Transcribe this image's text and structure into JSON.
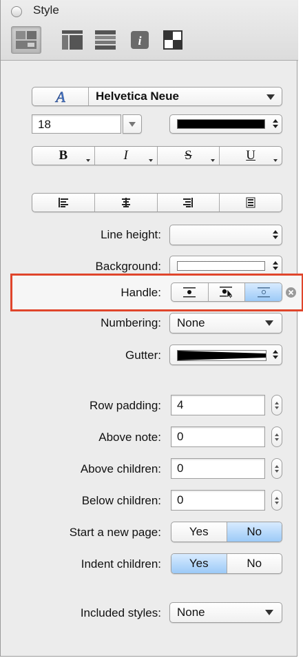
{
  "window": {
    "title": "Style"
  },
  "tabs": [
    {
      "icon": "style-grid-icon",
      "selected": true
    },
    {
      "icon": "columns-icon",
      "selected": false
    },
    {
      "icon": "rows-icon",
      "selected": false
    },
    {
      "icon": "info-icon",
      "selected": false
    },
    {
      "icon": "squares-icon",
      "selected": false
    }
  ],
  "font": {
    "name": "Helvetica Neue",
    "size": "18",
    "color": "#000000"
  },
  "text_style_buttons": {
    "bold": "B",
    "italic": "I",
    "strike": "S",
    "underline": "U"
  },
  "alignment_buttons": [
    "align-left-icon",
    "align-center-icon",
    "align-right-icon",
    "align-justify-icon"
  ],
  "labels": {
    "line_height": "Line height:",
    "background": "Background:",
    "handle": "Handle:",
    "numbering": "Numbering:",
    "gutter": "Gutter:",
    "row_padding": "Row padding:",
    "above_note": "Above note:",
    "above_children": "Above children:",
    "below_children": "Below children:",
    "start_new_page": "Start a new page:",
    "indent_children": "Indent children:",
    "included_styles": "Included styles:"
  },
  "values": {
    "line_height": "",
    "numbering": "None",
    "row_padding": "4",
    "above_note": "0",
    "above_children": "0",
    "below_children": "0",
    "included_styles": "None"
  },
  "handle_selected_index": 2,
  "start_new_page": {
    "yes": "Yes",
    "no": "No",
    "selected": "No"
  },
  "indent_children": {
    "yes": "Yes",
    "no": "No",
    "selected": "Yes"
  },
  "colors": {
    "highlight": "#e0452b",
    "selected_segment": "#9ccaf7"
  }
}
